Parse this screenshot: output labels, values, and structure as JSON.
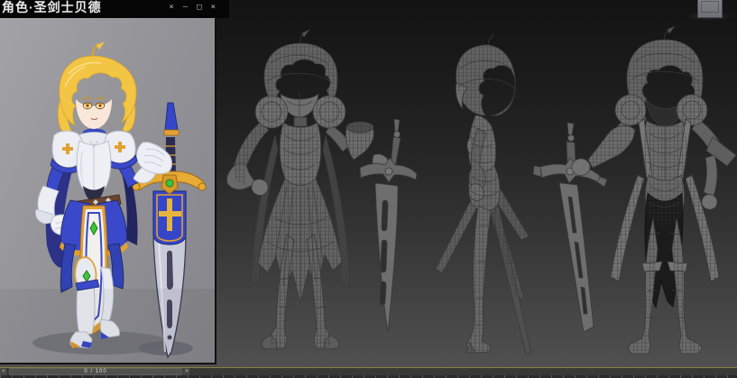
{
  "ref_window": {
    "title": "角色·圣剑士贝德",
    "controls": [
      {
        "name": "pin",
        "glyph": "×"
      },
      {
        "name": "minimize",
        "glyph": "—"
      },
      {
        "name": "maximize",
        "glyph": "□"
      },
      {
        "name": "close",
        "glyph": "×"
      }
    ]
  },
  "viewport": {
    "views": [
      "front-wireframe",
      "side-wireframe",
      "back-wireframe"
    ],
    "widget": "view-cube"
  },
  "timeline": {
    "prev_frame": "<",
    "frame_indicator": "0 / 100",
    "next_frame": ">"
  },
  "colors": {
    "viewport_top": "#131313",
    "viewport_bottom": "#525252",
    "wire": "#383838",
    "model_fill": "#6a6a6a",
    "active_border": "#83833f",
    "timeline_bg": "#3d3d3d",
    "timeline_handle": "#505050",
    "trackbar_bg": "#2b2b2b",
    "titlebar_bg": "#050505",
    "titlebar_text": "#ececec",
    "image_bg_top": "#a3a3a7",
    "image_bg_bottom": "#85858b",
    "hair_gold": "#f3c545",
    "armor_white": "#eef0f5",
    "armor_blue": "#3a49c9",
    "navy": "#262a6e",
    "trim_gold": "#e2a033",
    "gem_green": "#3fc43c",
    "blade_silver": "#c9cbd8"
  }
}
